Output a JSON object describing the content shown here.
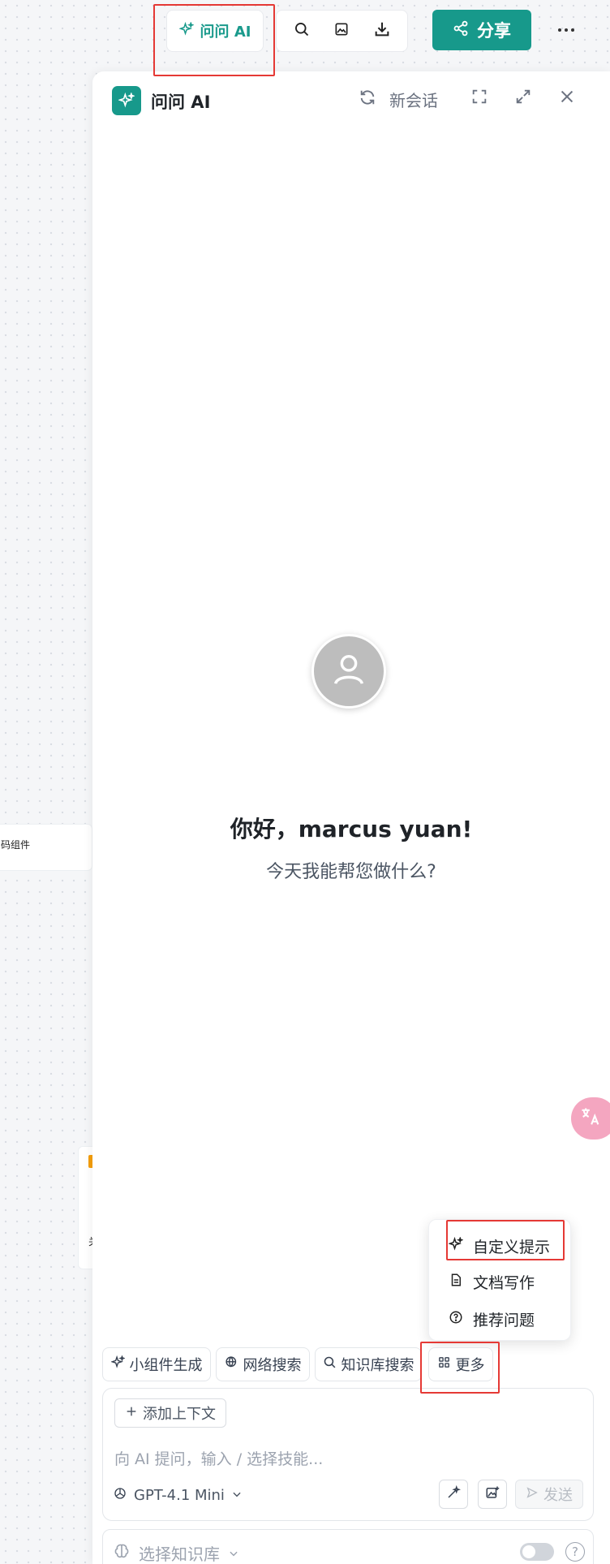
{
  "toolbar": {
    "ask_ai_label": "问问 AI",
    "share_label": "分享",
    "icons": [
      "search-icon",
      "image-icon",
      "download-icon"
    ]
  },
  "canvas": {
    "card_text": "码组件",
    "card2_text": "关"
  },
  "panel": {
    "title": "问问 AI",
    "new_session_label": "新会话",
    "greeting": "你好，marcus yuan!",
    "subtitle": "今天我能帮您做什么?"
  },
  "more_menu": {
    "items": [
      {
        "label": "自定义提示",
        "icon": "sparkle-icon"
      },
      {
        "label": "文档写作",
        "icon": "document-icon"
      },
      {
        "label": "推荐问题",
        "icon": "question-icon"
      }
    ]
  },
  "skills": {
    "widget_label": "小组件生成",
    "web_search_label": "网络搜索",
    "kb_search_label": "知识库搜索",
    "more_label": "更多"
  },
  "input": {
    "add_context_label": "添加上下文",
    "placeholder": "向 AI 提问，输入 / 选择技能...",
    "model_label": "GPT-4.1 Mini",
    "send_label": "发送"
  },
  "knowledge": {
    "select_label": "选择知识库"
  },
  "colors": {
    "accent": "#17998b",
    "highlight": "#e53935"
  }
}
